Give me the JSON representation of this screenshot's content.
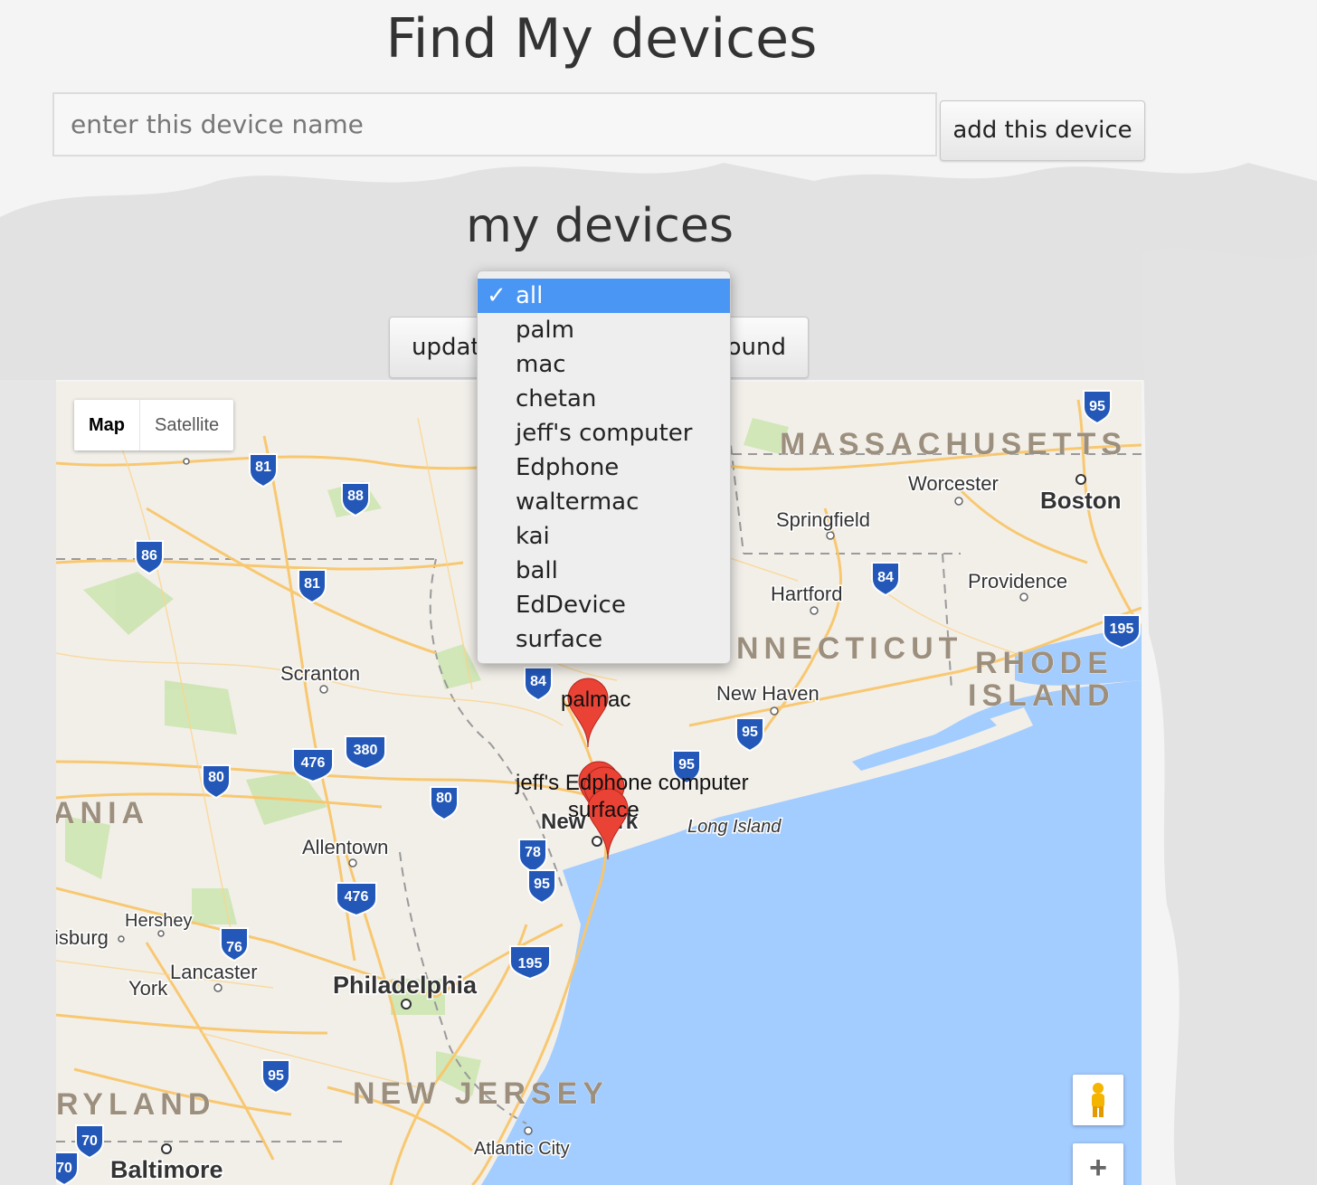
{
  "page": {
    "title": "Find My devices",
    "section_title": "my devices"
  },
  "add_device": {
    "input_placeholder": "enter this device name",
    "input_value": "",
    "button_label": "add this device"
  },
  "update_button": {
    "label_left": "update",
    "label_right": "ound"
  },
  "device_select": {
    "selected": "all",
    "check_glyph": "✓",
    "options": [
      "all",
      "palm",
      "mac",
      "chetan",
      "jeff's computer",
      "Edphone",
      "waltermac",
      "kai",
      "ball",
      "EdDevice",
      "surface"
    ]
  },
  "map": {
    "type_control": {
      "map_label": "Map",
      "satellite_label": "Satellite",
      "active": "Map"
    },
    "places": {
      "massachusetts": "MASSACHUSETTS",
      "worcester": "Worcester",
      "boston": "Boston",
      "springfield": "Springfield",
      "providence": "Providence",
      "hartford": "Hartford",
      "connecticut": "NNECTICUT",
      "rhode": "RHODE",
      "island": "ISLAND",
      "scranton": "Scranton",
      "new_haven": "New Haven",
      "new_york": "New York",
      "long_island": "Long Island",
      "ania": "ANIA",
      "allentown": "Allentown",
      "hershey": "Hershey",
      "isburg": "isburg",
      "lancaster": "Lancaster",
      "york": "York",
      "philadelphia": "Philadelphia",
      "new_jersey": "NEW JERSEY",
      "ryland": "RYLAND",
      "atlantic_city": "Atlantic City",
      "baltimore": "Baltimore"
    },
    "highway_shields": [
      "95",
      "81",
      "88",
      "86",
      "81",
      "84",
      "195",
      "84",
      "95",
      "95",
      "476",
      "380",
      "80",
      "80",
      "78",
      "95",
      "476",
      "76",
      "195",
      "95",
      "70",
      "70"
    ],
    "marker_labels": {
      "upper": "palmac",
      "middle": "jeff's Edphone computer",
      "lower": "surface"
    },
    "colors": {
      "water": "#a3ccff",
      "land": "#f2efe9",
      "highway": "#f9c66b",
      "marker": "#ea4335"
    },
    "icons": [
      "pegman-icon",
      "zoom-in-icon"
    ],
    "zoom_in_glyph": "+"
  }
}
